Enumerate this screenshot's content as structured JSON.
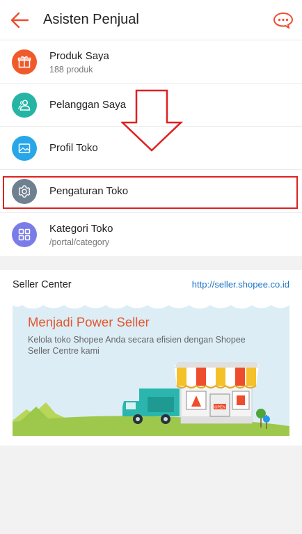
{
  "header": {
    "title": "Asisten Penjual"
  },
  "menu": [
    {
      "label": "Produk Saya",
      "sub": "188 produk",
      "color": "#f05a2b",
      "icon": "gift-icon"
    },
    {
      "label": "Pelanggan Saya",
      "sub": "",
      "color": "#26b5a4",
      "icon": "users-icon"
    },
    {
      "label": "Profil Toko",
      "sub": "",
      "color": "#27a6e8",
      "icon": "image-icon"
    },
    {
      "label": "Pengaturan Toko",
      "sub": "",
      "color": "#6f8090",
      "icon": "gear-icon"
    },
    {
      "label": "Kategori Toko",
      "sub": "/portal/category",
      "color": "#7a7de8",
      "icon": "grid-icon"
    }
  ],
  "seller_center": {
    "title": "Seller Center",
    "link": "http://seller.shopee.co.id",
    "banner": {
      "headline": "Menjadi Power Seller",
      "description": "Kelola toko Shopee Anda secara efisien dengan Shopee Seller Centre kami",
      "shop_sign": "OPEN"
    }
  },
  "colors": {
    "accent": "#ee4d2d",
    "highlight": "#e02020",
    "link": "#1a73c9"
  }
}
